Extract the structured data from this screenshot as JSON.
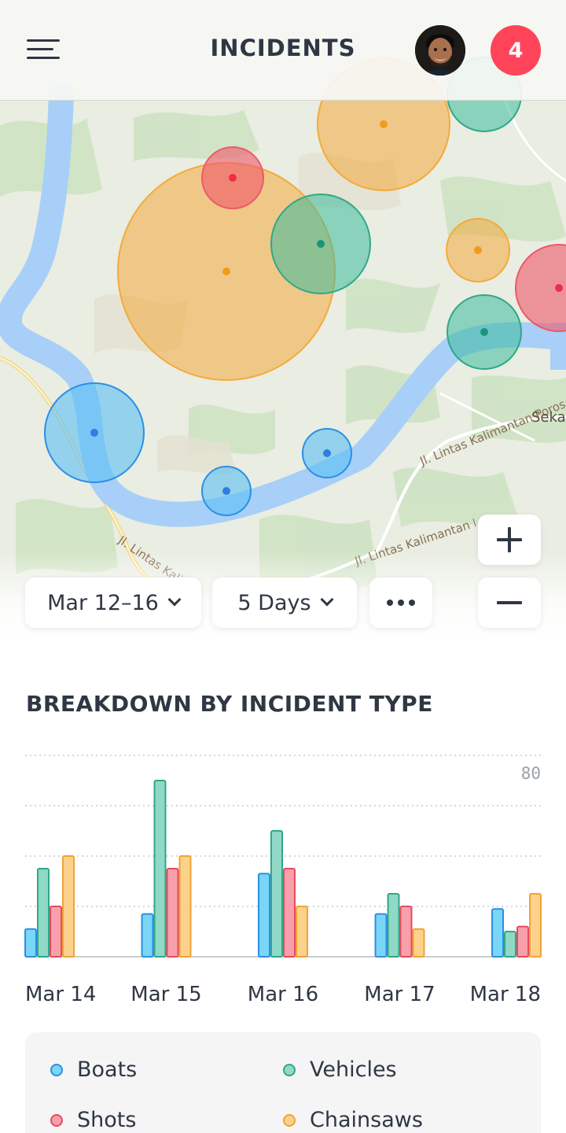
{
  "header": {
    "title": "INCIDENTS",
    "notification_count": "4"
  },
  "map": {
    "road_labels": [
      "Jl. Lintas Kalimantan Poros Tengah",
      "Seka",
      "Jl. Lintas Kalimantan Poros Tengah",
      "Jl. Lintas Kalimantan Poros Tengah"
    ],
    "markers": [
      {
        "type": "Chainsaws",
        "size": "large"
      },
      {
        "type": "Chainsaws",
        "size": "medium"
      },
      {
        "type": "Chainsaws",
        "size": "small"
      },
      {
        "type": "Shots",
        "size": "small"
      },
      {
        "type": "Shots",
        "size": "medium"
      },
      {
        "type": "Vehicles",
        "size": "medium"
      },
      {
        "type": "Vehicles",
        "size": "medium"
      },
      {
        "type": "Vehicles",
        "size": "medium"
      },
      {
        "type": "Boats",
        "size": "medium"
      },
      {
        "type": "Boats",
        "size": "small"
      },
      {
        "type": "Boats",
        "size": "small"
      }
    ]
  },
  "controls": {
    "date_range": "Mar 12–16",
    "duration": "5 Days",
    "more_icon": "more-horizontal-icon",
    "zoom_in_icon": "plus-icon",
    "zoom_out_icon": "minus-icon"
  },
  "breakdown": {
    "title": "BREAKDOWN BY INCIDENT TYPE"
  },
  "colors": {
    "Boats": "#29a8e8",
    "Vehicles": "#3dbb9d",
    "Shots": "#ee5769",
    "Chainsaws": "#f4aa3c",
    "notification": "#ff4459"
  },
  "chart_data": {
    "type": "bar",
    "categories": [
      "Mar 14",
      "Mar 15",
      "Mar 16",
      "Mar 17",
      "Mar 18"
    ],
    "series": [
      {
        "name": "Boats",
        "values": [
          11,
          17,
          33,
          17,
          19
        ]
      },
      {
        "name": "Vehicles",
        "values": [
          35,
          70,
          50,
          25,
          10
        ]
      },
      {
        "name": "Shots",
        "values": [
          20,
          35,
          35,
          20,
          12
        ]
      },
      {
        "name": "Chainsaws",
        "values": [
          40,
          40,
          20,
          11,
          25
        ]
      }
    ],
    "yticks": [
      "80"
    ],
    "ylim": [
      0,
      80
    ],
    "grid": true,
    "legend": "bottom"
  },
  "legend": {
    "items": [
      "Boats",
      "Vehicles",
      "Shots",
      "Chainsaws"
    ]
  }
}
